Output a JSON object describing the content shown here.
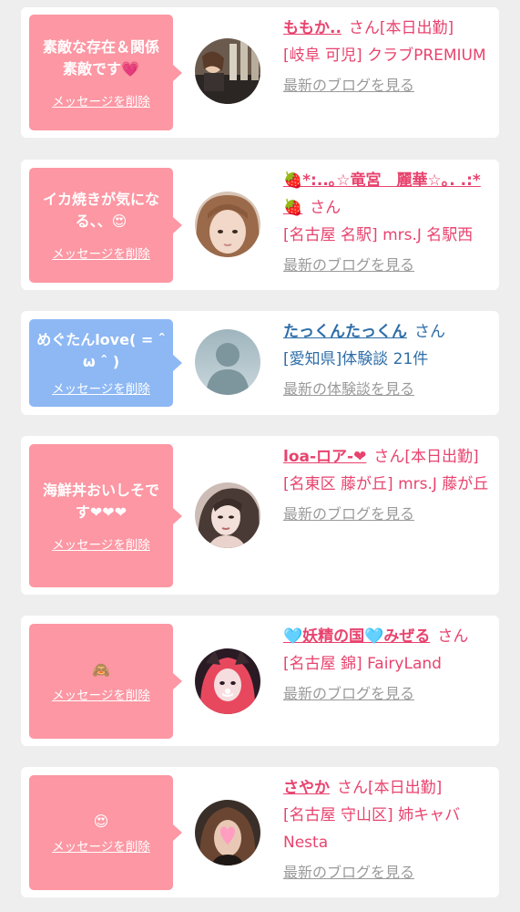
{
  "entries": [
    {
      "message": "素敵な存在＆関係素敵です💗",
      "delete_label": "メッセージを削除",
      "name": "ももか..",
      "san": "さん",
      "status": "[本日出勤]",
      "shop": "[岐阜 可児] クラブPREMIUM",
      "link": "最新のブログを見る"
    },
    {
      "message": "イカ焼きが気になる、、😍",
      "delete_label": "メッセージを削除",
      "name": "🍓*:..｡☆竜宮　麗華☆｡. .:*🍓",
      "san": "さん",
      "shop": "[名古屋 名駅] mrs.J 名駅西",
      "link": "最新のブログを見る"
    },
    {
      "message": "めぐたんlove( = ˆ ω ˆ )",
      "delete_label": "メッセージを削除",
      "name": "たっくんたっくん",
      "san": "さん",
      "shop": "[愛知県]体験談 21件",
      "link": "最新の体験談を見る",
      "avatar_text": "no photo"
    },
    {
      "message": "海鮮丼おいしそです❤❤❤",
      "delete_label": "メッセージを削除",
      "name": "loa-ロア-❤",
      "san": "さん",
      "status": "[本日出勤]",
      "shop": "[名東区 藤が丘] mrs.J 藤が丘",
      "link": "最新のブログを見る"
    },
    {
      "message": "🙈",
      "delete_label": "メッセージを削除",
      "name": "🩵妖精の国🩵みぜる",
      "san": "さん",
      "shop": "[名古屋 錦] FairyLand",
      "link": "最新のブログを見る"
    },
    {
      "message": "😍",
      "delete_label": "メッセージを削除",
      "name": "さやか",
      "san": "さん",
      "status": "[本日出勤]",
      "shop": "[名古屋 守山区] 姉キャバNesta",
      "link": "最新のブログを見る"
    }
  ],
  "colors": {
    "background": "#eeeeee",
    "card": "#ffffff",
    "bubble_pink": "#fc97a3",
    "bubble_blue": "#8db8f4",
    "name_pink": "#e8436e",
    "name_blue": "#2e6ea8",
    "link_gray": "#9a9a9a"
  }
}
